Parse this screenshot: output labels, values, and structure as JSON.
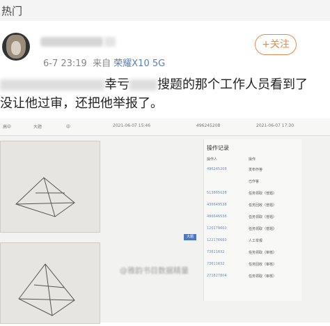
{
  "header": {
    "title": "热门"
  },
  "post": {
    "time": "6-7 23:19",
    "source_prefix": "来自",
    "source_device": "荣耀X10 5G",
    "follow_label": "+关注",
    "line1_a": "幸亏",
    "line1_b": "搜题的那个工作人员看到了",
    "line2": "没让他过审，还把他举报了。"
  },
  "screenshot": {
    "hdr_subject": "高中",
    "hdr_type": "大题",
    "hdr_grade": "中",
    "hdr_date1": "2021-06-07 15:46",
    "hdr_id": "496245208",
    "hdr_date2": "2021-06-07 17:30",
    "panel_title": "操作记录",
    "col_user": "操作人",
    "col_action": "操作",
    "badge": "大题",
    "rows": [
      {
        "user": "496245208",
        "action": "发布作答"
      },
      {
        "user": "",
        "action": "已作答"
      },
      {
        "user": "513865028",
        "action": "任务领取（普题）"
      },
      {
        "user": "436649538",
        "action": "任务回收（普题）"
      },
      {
        "user": "496646538",
        "action": "任务领取（普题）"
      },
      {
        "user": "120179660",
        "action": "任务领取（普题）"
      },
      {
        "user": "122176660",
        "action": "人工举报"
      },
      {
        "user": "73611632",
        "action": "任务领取（审核）"
      },
      {
        "user": "73611632",
        "action": "任务回收（审核）"
      },
      {
        "user": "271827804",
        "action": "任务领取（审核）"
      }
    ],
    "watermark": "@雅韵书目数据精量"
  }
}
